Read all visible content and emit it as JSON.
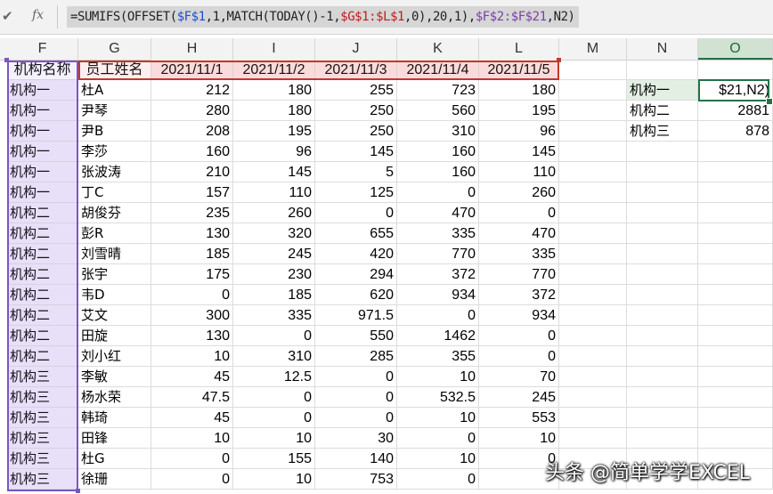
{
  "formula_bar": {
    "check_icon": "✔",
    "fx_label": "fx",
    "formula_parts": [
      {
        "text": "=SUMIFS(OFFSET(",
        "c": ""
      },
      {
        "text": "$F$1",
        "c": "c-f"
      },
      {
        "text": ",1,MATCH(TODAY()-1,",
        "c": ""
      },
      {
        "text": "$G$1:$L$1",
        "c": "c-g"
      },
      {
        "text": ",0),20,1),",
        "c": ""
      },
      {
        "text": "$F$2:$F$21",
        "c": "c-l"
      },
      {
        "text": ",N2)",
        "c": ""
      }
    ]
  },
  "columns": [
    "F",
    "G",
    "H",
    "I",
    "J",
    "K",
    "L",
    "M",
    "N",
    "O"
  ],
  "selected_column": "O",
  "headers": [
    "机构名称",
    "员工姓名",
    "2021/11/1",
    "2021/11/2",
    "2021/11/3",
    "2021/11/4",
    "2021/11/5"
  ],
  "rows": [
    [
      "机构一",
      "杜A",
      "212",
      "180",
      "255",
      "723",
      "180"
    ],
    [
      "机构一",
      "尹琴",
      "280",
      "180",
      "250",
      "560",
      "195"
    ],
    [
      "机构一",
      "尹B",
      "208",
      "195",
      "250",
      "310",
      "96"
    ],
    [
      "机构一",
      "李莎",
      "160",
      "96",
      "145",
      "160",
      "145"
    ],
    [
      "机构一",
      "张波涛",
      "210",
      "145",
      "5",
      "160",
      "110"
    ],
    [
      "机构一",
      "丁C",
      "157",
      "110",
      "125",
      "0",
      "260"
    ],
    [
      "机构二",
      "胡俊芬",
      "235",
      "260",
      "0",
      "470",
      "0"
    ],
    [
      "机构二",
      "彭R",
      "130",
      "320",
      "655",
      "335",
      "470"
    ],
    [
      "机构二",
      "刘雪晴",
      "185",
      "245",
      "420",
      "770",
      "335"
    ],
    [
      "机构二",
      "张宇",
      "175",
      "230",
      "294",
      "372",
      "770"
    ],
    [
      "机构二",
      "韦D",
      "0",
      "185",
      "620",
      "934",
      "372"
    ],
    [
      "机构二",
      "艾文",
      "300",
      "335",
      "971.5",
      "0",
      "934"
    ],
    [
      "机构二",
      "田旋",
      "130",
      "0",
      "550",
      "1462",
      "0"
    ],
    [
      "机构二",
      "刘小红",
      "10",
      "310",
      "285",
      "355",
      "0"
    ],
    [
      "机构三",
      "李敏",
      "45",
      "12.5",
      "0",
      "10",
      "70"
    ],
    [
      "机构三",
      "杨水荣",
      "47.5",
      "0",
      "0",
      "532.5",
      "245"
    ],
    [
      "机构三",
      "韩琦",
      "45",
      "0",
      "0",
      "10",
      "553"
    ],
    [
      "机构三",
      "田锋",
      "10",
      "10",
      "30",
      "0",
      "10"
    ],
    [
      "机构三",
      "杜G",
      "0",
      "155",
      "140",
      "10",
      "0"
    ],
    [
      "机构三",
      "徐珊",
      "0",
      "10",
      "753",
      "0",
      ""
    ]
  ],
  "summary": [
    {
      "name": "机构一",
      "value": "$21,N2)"
    },
    {
      "name": "机构二",
      "value": "2881"
    },
    {
      "name": "机构三",
      "value": "878"
    }
  ],
  "watermark": "头条 @简单学学EXCEL"
}
